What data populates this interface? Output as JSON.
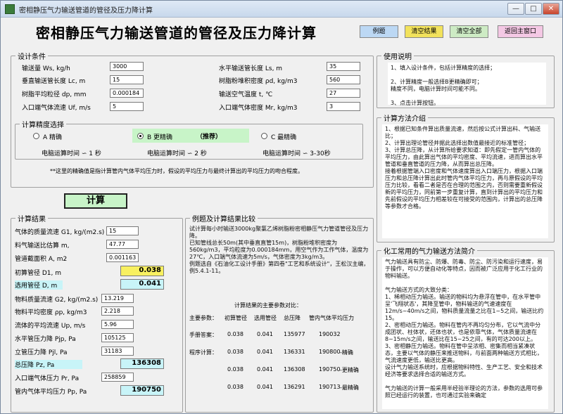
{
  "window": {
    "title": "密相静压气力输送管道的管径及压力降计算",
    "min": "—",
    "max": "□",
    "close": "✕"
  },
  "header": {
    "title": "密相静压气力输送管道的管径及压力降计算",
    "buttons": {
      "example": "例题",
      "clear_results": "清空结果",
      "clear_all": "清空全部",
      "back": "返回主窗口"
    }
  },
  "design": {
    "legend": "设计条件",
    "left": [
      {
        "label": "输送量 Ws, kg/h",
        "value": "3000"
      },
      {
        "label": "垂直输送管长度 Lc, m",
        "value": "15"
      },
      {
        "label": "树脂平均粒径 dp, mm",
        "value": "0.000184"
      },
      {
        "label": "入口端气体流速 Uf, m/s",
        "value": "5"
      }
    ],
    "right": [
      {
        "label": "水平输送管长度 Ls, m",
        "value": "35"
      },
      {
        "label": "树脂粉堆积密度 ρd, kg/m3",
        "value": "560"
      },
      {
        "label": "输送空气温度 t, ℃",
        "value": "27"
      },
      {
        "label": "入口端气体密度 Mr, kg/m3",
        "value": "3"
      }
    ]
  },
  "precision": {
    "legend": "计算精度选择",
    "options": [
      {
        "label": "A 精确",
        "time": "电脑运算时间 ∽ 1 秒"
      },
      {
        "label": "B 更精确",
        "tag": "（推荐）",
        "time": "电脑运算时间 ∽ 2 秒"
      },
      {
        "label": "C 最精确",
        "time": "电脑运算时间 ∽ 3-30秒"
      }
    ],
    "note": "**这里的精确值是指计算管内气体平均压力时，假设的平均压力与最终计算出的平均压力的吻合程度。"
  },
  "calc_button": "计算",
  "results": {
    "legend": "计算结果",
    "rows": [
      {
        "label": "气体的质量流速 G1, kg/(m2.s)",
        "value": "15"
      },
      {
        "label": "料气输送比估算 m,",
        "value": "47.77"
      },
      {
        "label": "管道截面积 A, m2",
        "value": "0.001163"
      },
      {
        "label": "初算管径 D1, m",
        "value": "0.038"
      },
      {
        "label": "选用管径 D, m",
        "value": "0.041"
      },
      {
        "label": "物料质量流速 G2, kg/(m2.s)",
        "value": "13.219"
      },
      {
        "label": "物料平均密度 ρp, kg/m3",
        "value": "2.218"
      },
      {
        "label": "流体的平均流速 Up, m/s",
        "value": "5.96"
      },
      {
        "label": "水平管压力降 Pjp, Pa",
        "value": "105125"
      },
      {
        "label": "立管压力降 Pjl, Pa",
        "value": "31183"
      },
      {
        "label": "总压降 Pz, Pa",
        "value": "136308"
      },
      {
        "label": "入口端气体压力 Pr, Pa",
        "value": "258859"
      },
      {
        "label": "管内气体平均压力 Pp, Pa",
        "value": "190750"
      }
    ]
  },
  "usage": {
    "legend": "使用说明",
    "text": "1、填入设计条件，包括计算精度的选择；\n\n2、计算精度一般选择B更精确即可；\n   精度不同，电脑计算时间可能不同。\n\n3、点击计算按钮。"
  },
  "method": {
    "legend": "计算方法介绍",
    "text": "    1、根据已知条件算出质量流速，然后按公式计算出料、气输送比；\n    2、计算出理论管径并据此选择出数值最接近的标准管径；\n    3、计算总压降，从计算所给要求知道：即先假定一管内气体的平均压力，由此算出气体的平均密度、平均流速，进而算出水平管道和垂直管道的压力降，从而算出总压降。\n    接着根据管端入口密度和气体速度算出入口端压力，根据入口端压力和总压降计算出此时管内气体平均压力，再与原假设的平均压力比较，看看二者是否在合理的范围之内，否则需要重新假设新的平均压力，同前第一步重复计算，直到计算出的平均压力和先前假设的平均压力相差较在可接受的范围内，计算出的总压降等参数才合格。"
  },
  "common": {
    "legend": "化工常用的气力输送方法简介",
    "text": "    气力输送具有防尘、防爆、防毒、防尘、防污染和运行速度，易于操作，可以方便自动化等特点，因而被广泛应用于化工行业的物料输送。\n\n    气力输送方式的大致分类：\n    1、稀相动压力输送。输送的物料均为悬浮在管中，在水平管中呈'飞翔状态'，其降至管中，物料输送的气速速度在12m/s~40m/s之间，物料质量流量之比在1~5之间，输送比约15。\n    2、密相动压力输送。物料在管内不再均匀分布，它以气流中分成团状、柱体状，还体也状，也是依靠气体，气体质量流速在8~15m/s之间，输送比在15~25之间，有的可达200以上。\n    3、密相静压力输送。物料在管中呈浓相、密集而相当紧凑状态，主要以气体的静压来推送物料，与前面两种输送方式相比，气流速度更低，输送比更高。\n    设计气力输送系统时，应根据物料特性、生产工艺、安全和技术经济等要求选择合适的输送方式。\n\n    气力输送的计算一般采用半经验半理论的方法，参数的选用可参照已经运行的装置，也可通过实验来确定"
  },
  "compare": {
    "legend": "例题及计算结果比较",
    "intro": "    试计算每小时输送3000kg聚氯乙烯树脂粉密相静压气力管道管径及压力降。\n    已知管线总长50m(其中垂直直管15m)，树脂粉堆积密度为560kg/m3，平均粒度为0.000184mm，用空气作为工作气体，温度为27℃，入口端气体流速为5m/s，气体密度为3kg/m3。\n    例题选自《石油化工设计手册》第四卷\"工艺和系统设计\"，王松汉主编，例5.4.1-11。",
    "table_title": "计算结果的主要参数对比：",
    "header": [
      "主要参数：",
      "初算管径",
      "选用管径",
      "总压降",
      "管内气体平均压力"
    ],
    "rows": [
      {
        "label": "手册答案：",
        "cells": [
          "0.038",
          "0.041",
          "135977",
          "190032",
          ""
        ]
      },
      {
        "label": "程序计算：",
        "cells": [
          "0.038",
          "0.041",
          "136331",
          "190800",
          "-精确"
        ]
      },
      {
        "label": "",
        "cells": [
          "0.038",
          "0.041",
          "136308",
          "190750",
          "-更精确"
        ]
      },
      {
        "label": "",
        "cells": [
          "0.038",
          "0.041",
          "136291",
          "190713",
          "-最精确"
        ]
      }
    ]
  },
  "colors": {
    "yellow": "#f8f060",
    "cyan": "#c8f4f8",
    "green": "#c8f4c8"
  }
}
